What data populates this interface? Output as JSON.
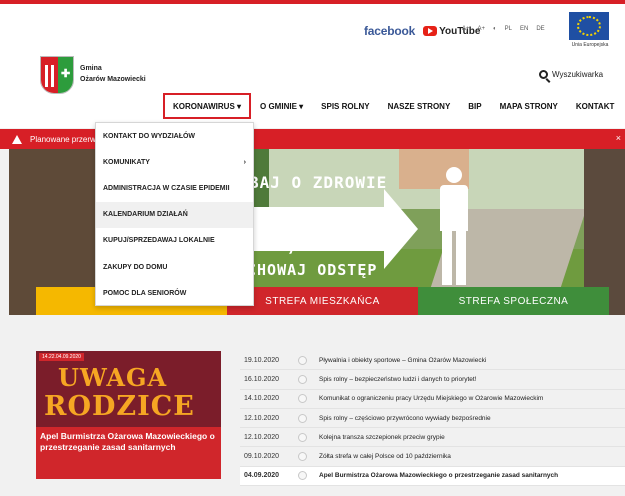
{
  "social": {
    "facebook": "facebook",
    "youtube": "YouTube"
  },
  "accessibility": {
    "font_small": "A+",
    "font_large": "A+",
    "contrast": "◐",
    "lang_pl": "PL",
    "lang_en": "EN",
    "lang_de": "DE"
  },
  "eu": {
    "label": "Unia Europejska"
  },
  "brand": {
    "line1": "Gmina",
    "line2": "Ożarów Mazowiecki"
  },
  "search": {
    "label": "Wyszukiwarka"
  },
  "nav": {
    "items": [
      {
        "label": "KORONAWIRUS ▾"
      },
      {
        "label": "O GMINIE ▾"
      },
      {
        "label": "SPIS ROLNY"
      },
      {
        "label": "NASZE STRONY"
      },
      {
        "label": "BIP"
      },
      {
        "label": "MAPA STRONY"
      },
      {
        "label": "KONTAKT"
      }
    ]
  },
  "alert": {
    "text": "Planowane przerw",
    "close": "×"
  },
  "hero": {
    "line1": "BAJ O ZDROWIE",
    "line2": "1,5 m",
    "line3": "CHOWAJ ODSTĘP"
  },
  "tabs": [
    {
      "label": "STREFA"
    },
    {
      "label": "STREFA MIESZKAŃCA"
    },
    {
      "label": "STREFA SPOŁECZNA"
    }
  ],
  "dropdown": {
    "items": [
      {
        "label": "KONTAKT DO WYDZIAŁÓW"
      },
      {
        "label": "KOMUNIKATY",
        "chevron": "›"
      },
      {
        "label": "ADMINISTRACJA W CZASIE EPIDEMII"
      },
      {
        "label": "KALENDARIUM DZIAŁAŃ"
      },
      {
        "label": "KUPUJ/SPRZEDAWAJ LOKALNIE"
      },
      {
        "label": "ZAKUPY DO DOMU"
      },
      {
        "label": "POMOC DLA SENIORÓW"
      }
    ]
  },
  "news_card": {
    "date": "14.22.04.09.2020",
    "img_line1": "UWAGA",
    "img_line2": "RODZICE",
    "title": "Apel Burmistrza Ożarowa Mazowieckiego o przestrzeganie zasad sanitarnych"
  },
  "news_list": [
    {
      "date": "19.10.2020",
      "title": "Pływalnia i obiekty sportowe – Gmina Ożarów Mazowiecki"
    },
    {
      "date": "16.10.2020",
      "title": "Spis rolny – bezpieczeństwo ludzi i danych to priorytet!"
    },
    {
      "date": "14.10.2020",
      "title": "Komunikat o ograniczeniu pracy Urzędu Miejskiego w Ożarowie Mazowieckim"
    },
    {
      "date": "12.10.2020",
      "title": "Spis rolny – częściowo przywrócono wywiady bezpośrednie"
    },
    {
      "date": "12.10.2020",
      "title": "Kolejna transza szczepionek przeciw grypie"
    },
    {
      "date": "09.10.2020",
      "title": "Żółta strefa w całej Polsce od 10 października"
    },
    {
      "date": "04.09.2020",
      "title": "Apel Burmistrza Ożarowa Mazowieckiego o przestrzeganie zasad sanitarnych"
    }
  ]
}
